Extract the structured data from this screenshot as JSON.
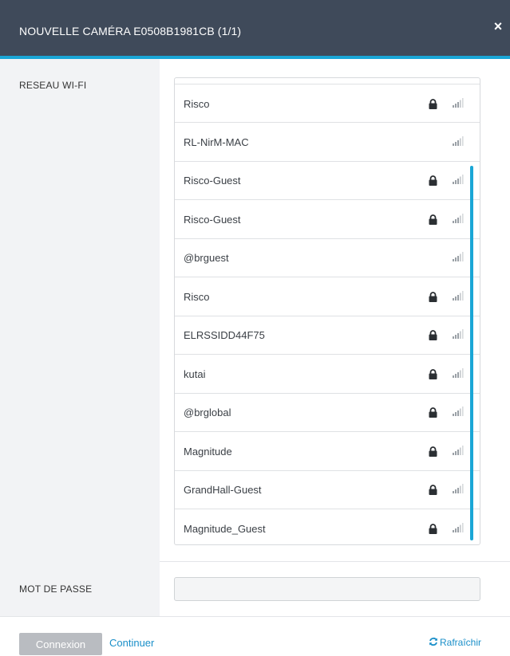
{
  "header": {
    "title": "NOUVELLE CAMÉRA E0508B1981CB (1/1)",
    "close_icon": "×"
  },
  "labels": {
    "wifi": "RESEAU WI-FI",
    "password": "MOT DE PASSE"
  },
  "networks": [
    {
      "name": "Risco",
      "locked": true
    },
    {
      "name": "RL-NirM-MAC",
      "locked": false
    },
    {
      "name": "Risco-Guest",
      "locked": true
    },
    {
      "name": "Risco-Guest",
      "locked": true
    },
    {
      "name": "@brguest",
      "locked": false
    },
    {
      "name": "Risco",
      "locked": true
    },
    {
      "name": "ELRSSIDD44F75",
      "locked": true
    },
    {
      "name": "kutai",
      "locked": true
    },
    {
      "name": "@brglobal",
      "locked": true
    },
    {
      "name": "Magnitude",
      "locked": true
    },
    {
      "name": "GrandHall-Guest",
      "locked": true
    },
    {
      "name": "Magnitude_Guest",
      "locked": true
    }
  ],
  "password_value": "",
  "footer": {
    "connect_label": "Connexion",
    "continue_label": "Continuer",
    "refresh_label": "Rafraîchir"
  },
  "colors": {
    "header_bg": "#3f4a5a",
    "accent": "#1aa6d6",
    "link": "#1a8fc9"
  }
}
